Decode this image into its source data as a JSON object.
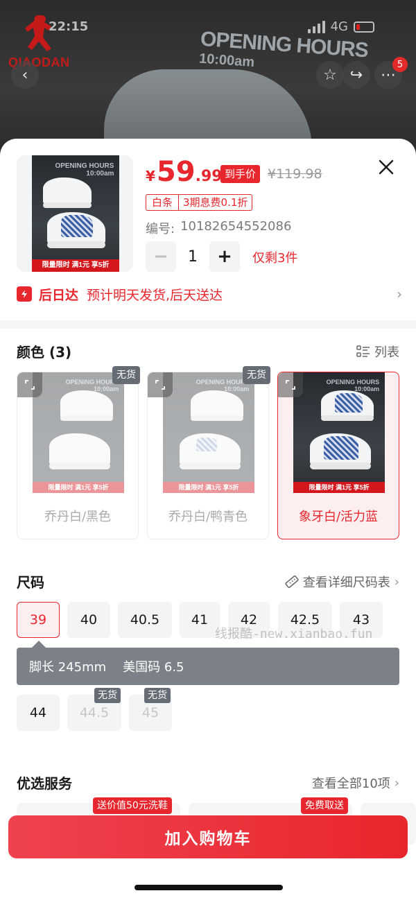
{
  "status_bar": {
    "time": "22:15",
    "network": "4G"
  },
  "backdrop": {
    "brand_logo": "QIAODAN",
    "sign_line1": "OPENING HOURS",
    "sign_line2": "10:00am",
    "cart_badge": "5",
    "icons": [
      "back-icon",
      "star-icon",
      "share-icon",
      "more-icon"
    ]
  },
  "product": {
    "currency": "¥",
    "price_int": "59",
    "price_dec": ".99",
    "price_tag": "到手价",
    "original_price": "¥119.98",
    "promo_left": "白条",
    "promo_right": "3期息费0.1折",
    "sku_label": "编号:",
    "sku_value": "10182654552086",
    "quantity": "1",
    "stock_text": "仅剩3件",
    "thumb_banner": "限量限时 满1元 享5折"
  },
  "delivery": {
    "title": "后日达",
    "text": "预计明天发货,后天送达"
  },
  "colors": {
    "title": "颜色 (3)",
    "view_toggle": "列表",
    "soldout_label": "无货",
    "options": [
      {
        "label": "乔丹白/黑色",
        "soldout": true,
        "selected": false
      },
      {
        "label": "乔丹白/鸭青色",
        "soldout": true,
        "selected": false
      },
      {
        "label": "象牙白/活力蓝",
        "soldout": false,
        "selected": true
      }
    ]
  },
  "sizes": {
    "title": "尺码",
    "chart_link": "查看详细尺码表",
    "soldout_label": "无货",
    "options": [
      "39",
      "40",
      "40.5",
      "41",
      "42",
      "42.5",
      "43",
      "44",
      "44.5",
      "45"
    ],
    "selected": "39",
    "disabled": [
      "44.5",
      "45"
    ],
    "tip_foot_length": "脚长 245mm",
    "tip_us_size": "美国码 6.5"
  },
  "watermark": "线报酷-new.xianbao.fun",
  "services": {
    "title": "优选服务",
    "view_all": "查看全部10项",
    "tag_1": "送价值50元洗鞋",
    "tag_2": "免费取送"
  },
  "cta": {
    "add_to_cart": "加入购物车"
  },
  "theme": {
    "accent": "#e8262d",
    "muted": "#f3f4f6",
    "tip_bg": "#7c8087"
  }
}
